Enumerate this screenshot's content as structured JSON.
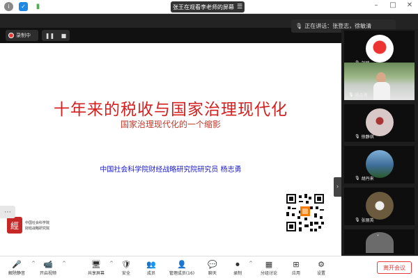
{
  "window": {
    "title": "张王在观看李老师的屏幕",
    "controls": [
      "–",
      "□",
      "✕"
    ]
  },
  "recording": {
    "label": "录制中"
  },
  "speaking": {
    "text": "正在讲话：张登志，徐敏清"
  },
  "slide": {
    "title": "十年来的税收与国家治理现代化",
    "subtitle": "国家治理现代化的一个缩影",
    "author": "中国社会科学院财经战略研究院研究员 杨志勇",
    "logo_lines": [
      "中国社会科学院",
      "财经战略研究院"
    ],
    "seal_char": "經"
  },
  "gallery": [
    {
      "name": "刘玮",
      "avatar_color": "#d8d8d8"
    },
    {
      "name": "杨志勇",
      "avatar_color": "#cfd8c8"
    },
    {
      "name": "徐静琪",
      "avatar_color": "#c9b8b8"
    },
    {
      "name": "胡丹来",
      "avatar_color": "#4a7bb0"
    },
    {
      "name": "张丽英",
      "avatar_color": "#6b5a3d"
    },
    {
      "name": "",
      "avatar_color": "#6b6b6b"
    }
  ],
  "toolbar": {
    "items": [
      {
        "label": "解除静音",
        "icon": "🎤"
      },
      {
        "label": "开启视频",
        "icon": "📹"
      },
      {
        "label": "共享屏幕",
        "icon": "🖥"
      },
      {
        "label": "安全",
        "icon": "🛡"
      },
      {
        "label": "成员",
        "icon": "👥"
      },
      {
        "label": "管理成员(16)",
        "icon": "👤"
      },
      {
        "label": "聊天",
        "icon": "💬"
      },
      {
        "label": "录制",
        "icon": "⏺"
      },
      {
        "label": "分组讨论",
        "icon": "▦"
      },
      {
        "label": "应用",
        "icon": "⊞"
      },
      {
        "label": "设置",
        "icon": "⚙"
      }
    ],
    "leave_label": "离开会议"
  }
}
